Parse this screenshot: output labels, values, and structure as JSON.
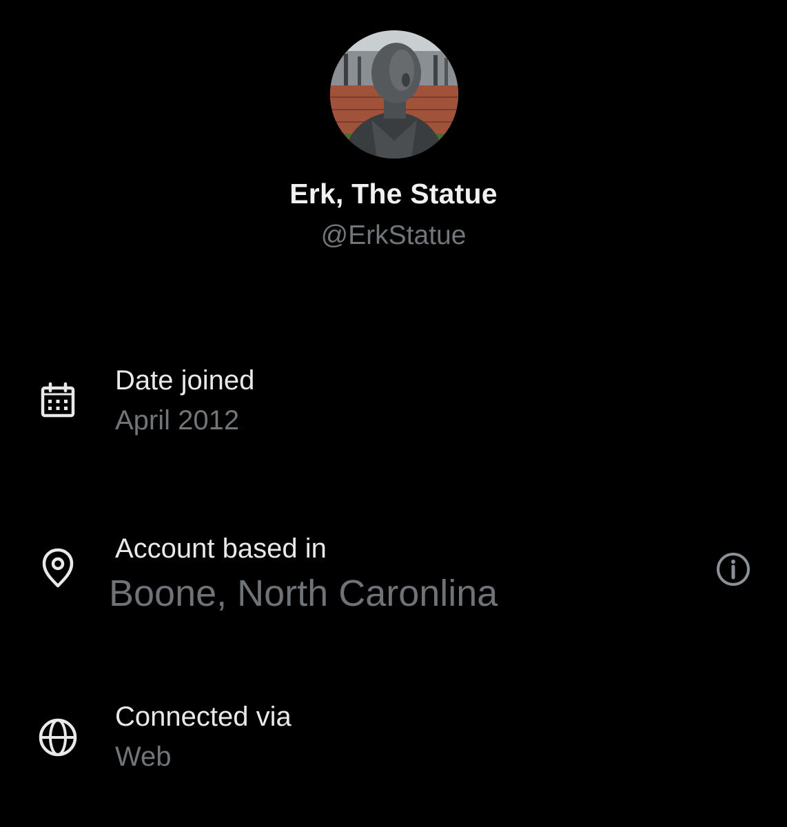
{
  "profile": {
    "display_name": "Erk, The Statue",
    "handle": "@ErkStatue",
    "avatar_icon": "profile-avatar-photo"
  },
  "rows": [
    {
      "icon": "calendar-icon",
      "label": "Date joined",
      "value": "April 2012"
    },
    {
      "icon": "location-pin-icon",
      "label": "Account based in",
      "value": "Boone, North Caronlina",
      "action_icon": "info-icon"
    },
    {
      "icon": "globe-icon",
      "label": "Connected via",
      "value": "Web"
    }
  ],
  "colors": {
    "background": "#000000",
    "primary_text": "#e7e9ea",
    "secondary_text": "#71767b"
  }
}
